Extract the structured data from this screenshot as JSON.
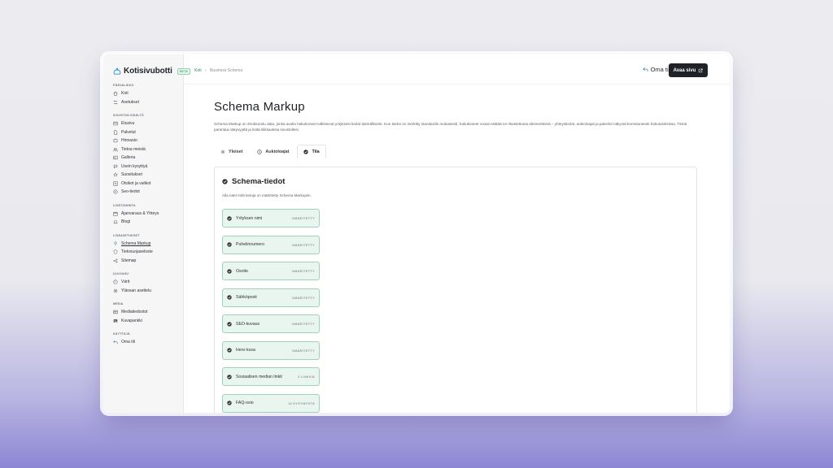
{
  "brand": {
    "name": "Kotisivubotti",
    "badge": "BETA"
  },
  "nav": {
    "sections": [
      {
        "title": "PÄÄVALIKKO",
        "items": [
          {
            "label": "Koti",
            "icon": "home-icon"
          },
          {
            "label": "Asetukset",
            "icon": "settings-icon"
          }
        ]
      },
      {
        "title": "SIVUSTON SISÄLTÖ",
        "items": [
          {
            "label": "Etusivu",
            "icon": "layout-icon"
          },
          {
            "label": "Palvelut",
            "icon": "document-icon"
          },
          {
            "label": "Hinnasto",
            "icon": "tag-icon"
          },
          {
            "label": "Tietoa meistä",
            "icon": "users-icon"
          },
          {
            "label": "Galleria",
            "icon": "image-icon"
          },
          {
            "label": "Usein kysyttyä",
            "icon": "question-icon"
          },
          {
            "label": "Suositukset",
            "icon": "star-icon"
          },
          {
            "label": "Otsikot ja valikot",
            "icon": "menu-icon"
          },
          {
            "label": "Seo-tiedot",
            "icon": "search-icon"
          }
        ]
      },
      {
        "title": "LISÄTOIMINTA",
        "items": [
          {
            "label": "Ajanvaraus & Yhteys",
            "icon": "calendar-icon"
          },
          {
            "label": "Blogi",
            "icon": "bell-icon"
          }
        ]
      },
      {
        "title": "LISÄASETUKSET",
        "items": [
          {
            "label": "Schema Markup",
            "icon": "pin-icon",
            "active": true
          },
          {
            "label": "Tietosuojaseloste",
            "icon": "shield-icon"
          },
          {
            "label": "Sitemap",
            "icon": "share-icon"
          }
        ]
      },
      {
        "title": "ULKOASU",
        "items": [
          {
            "label": "Värit",
            "icon": "palette-icon"
          },
          {
            "label": "Yläosan asettelu",
            "icon": "gear-icon"
          }
        ]
      },
      {
        "title": "MEDIA",
        "items": [
          {
            "label": "Mediatiedostot",
            "icon": "folder-icon"
          },
          {
            "label": "Kuvapankki",
            "icon": "photo-icon"
          }
        ]
      },
      {
        "title": "KÄYTTÄJÄ",
        "items": [
          {
            "label": "Oma tili",
            "icon": "back-arrow-icon"
          }
        ]
      }
    ]
  },
  "breadcrumb": {
    "home": "Koti",
    "separator": "›",
    "current": "Business Schema"
  },
  "header": {
    "account_label": "Oma tili",
    "open_label": "Avaa sivu"
  },
  "page": {
    "title": "Schema Markup",
    "description": "Schema Markup on strukturoitu data, jonka avulla hakukoneet tulkitsevat yrityksesi tiedot täsmällisesti. Kun tiedot on merkitty standardin mukaisesti, hakukoneet voivat esittää ne rikastettuina elementteinä – yhteystiedot, aukioloajat ja palvelut näkyvät korostuneesti hakutuloksissa. Tämä parantaa näkyvyyttä ja lisää klikkauksia sivustollesi."
  },
  "tabs": [
    {
      "label": "Yleiset",
      "icon": "gear-icon",
      "active": false
    },
    {
      "label": "Aukioloajat",
      "icon": "clock-icon",
      "active": false
    },
    {
      "label": "Tila",
      "icon": "check-circle-icon",
      "active": true
    }
  ],
  "panel": {
    "title": "Schema-tiedot",
    "subtitle": "Alla näet mitä tietoja on määritetty Schema Markupiin.",
    "fields": [
      {
        "name": "Yrityksen nimi",
        "status": "MÄÄRITETTY"
      },
      {
        "name": "Puhelinnumero",
        "status": "MÄÄRITETTY"
      },
      {
        "name": "Osoite",
        "status": "MÄÄRITETTY"
      },
      {
        "name": "Sähköposti",
        "status": "MÄÄRITETTY"
      },
      {
        "name": "SEO-kuvaus",
        "status": "MÄÄRITETTY"
      },
      {
        "name": "Hero-kuva",
        "status": "MÄÄRITETTY"
      },
      {
        "name": "Sosiaalisen median linkit",
        "status": "3 LINKKIÄ"
      },
      {
        "name": "FAQ-osio",
        "status": "10 KYSYMYSTÄ"
      }
    ]
  },
  "colors": {
    "accent": "#2f8a62",
    "field_bg": "#e9f5ef",
    "field_border": "#9fd2bb",
    "dark_button": "#1f2226"
  }
}
